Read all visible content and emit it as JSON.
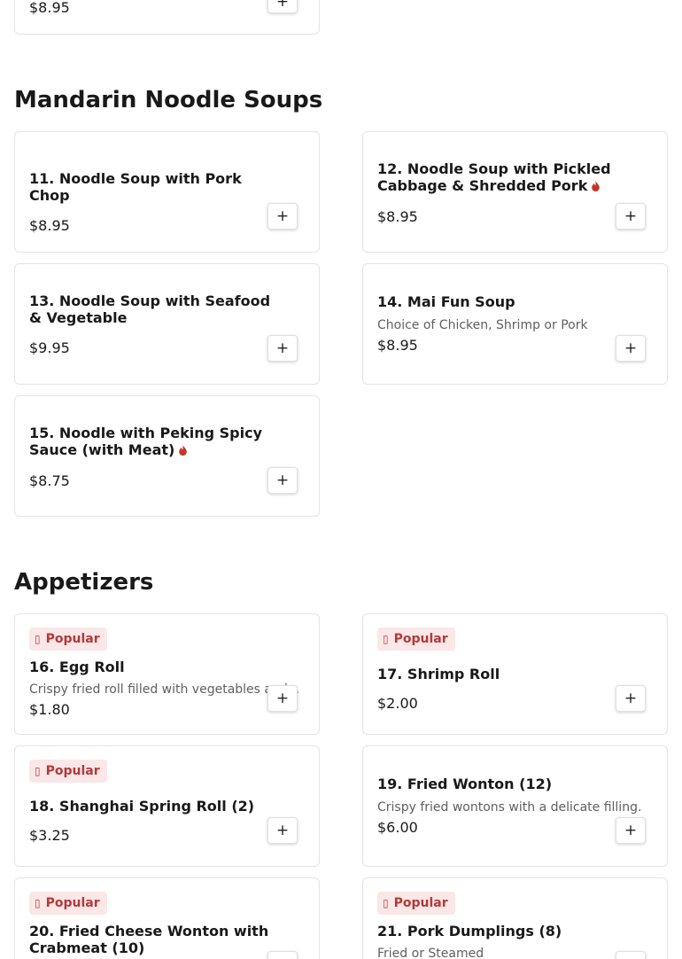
{
  "top_partial": {
    "price": "$8.95"
  },
  "sections": {
    "noodle_soups": {
      "title": "Mandarin Noodle Soups",
      "items": [
        {
          "name": "11. Noodle Soup with Pork Chop",
          "price": "$8.95"
        },
        {
          "name": "12. Noodle Soup with Pickled Cabbage & Shredded Pork",
          "price": "$8.95",
          "spicy": true
        },
        {
          "name": "13. Noodle Soup with Seafood & Vegetable",
          "price": "$9.95"
        },
        {
          "name": "14. Mai Fun Soup",
          "description": "Choice of Chicken, Shrimp or Pork",
          "price": "$8.95"
        },
        {
          "name": "15. Noodle with Peking Spicy Sauce (with Meat)",
          "price": "$8.75",
          "spicy": true
        }
      ]
    },
    "appetizers": {
      "title": "Appetizers",
      "items": [
        {
          "badge": "Popular",
          "name": "16. Egg Roll",
          "description": "Crispy fried roll filled with vegetables and...",
          "price": "$1.80"
        },
        {
          "badge": "Popular",
          "name": "17. Shrimp Roll",
          "price": "$2.00"
        },
        {
          "badge": "Popular",
          "name": "18. Shanghai Spring Roll (2)",
          "price": "$3.25"
        },
        {
          "name": "19. Fried Wonton (12)",
          "description": "Crispy fried wontons with a delicate filling.",
          "price": "$6.00"
        },
        {
          "badge": "Popular",
          "name": "20. Fried Cheese Wonton with Crabmeat (10)"
        },
        {
          "badge": "Popular",
          "name": "21. Pork Dumplings (8)",
          "description": "Fried or Steamed"
        }
      ]
    }
  },
  "add_label": "+",
  "colors": {
    "badge_bg": "#fbe7e7",
    "badge_text": "#b03a3a",
    "spicy": "#c0392b"
  }
}
